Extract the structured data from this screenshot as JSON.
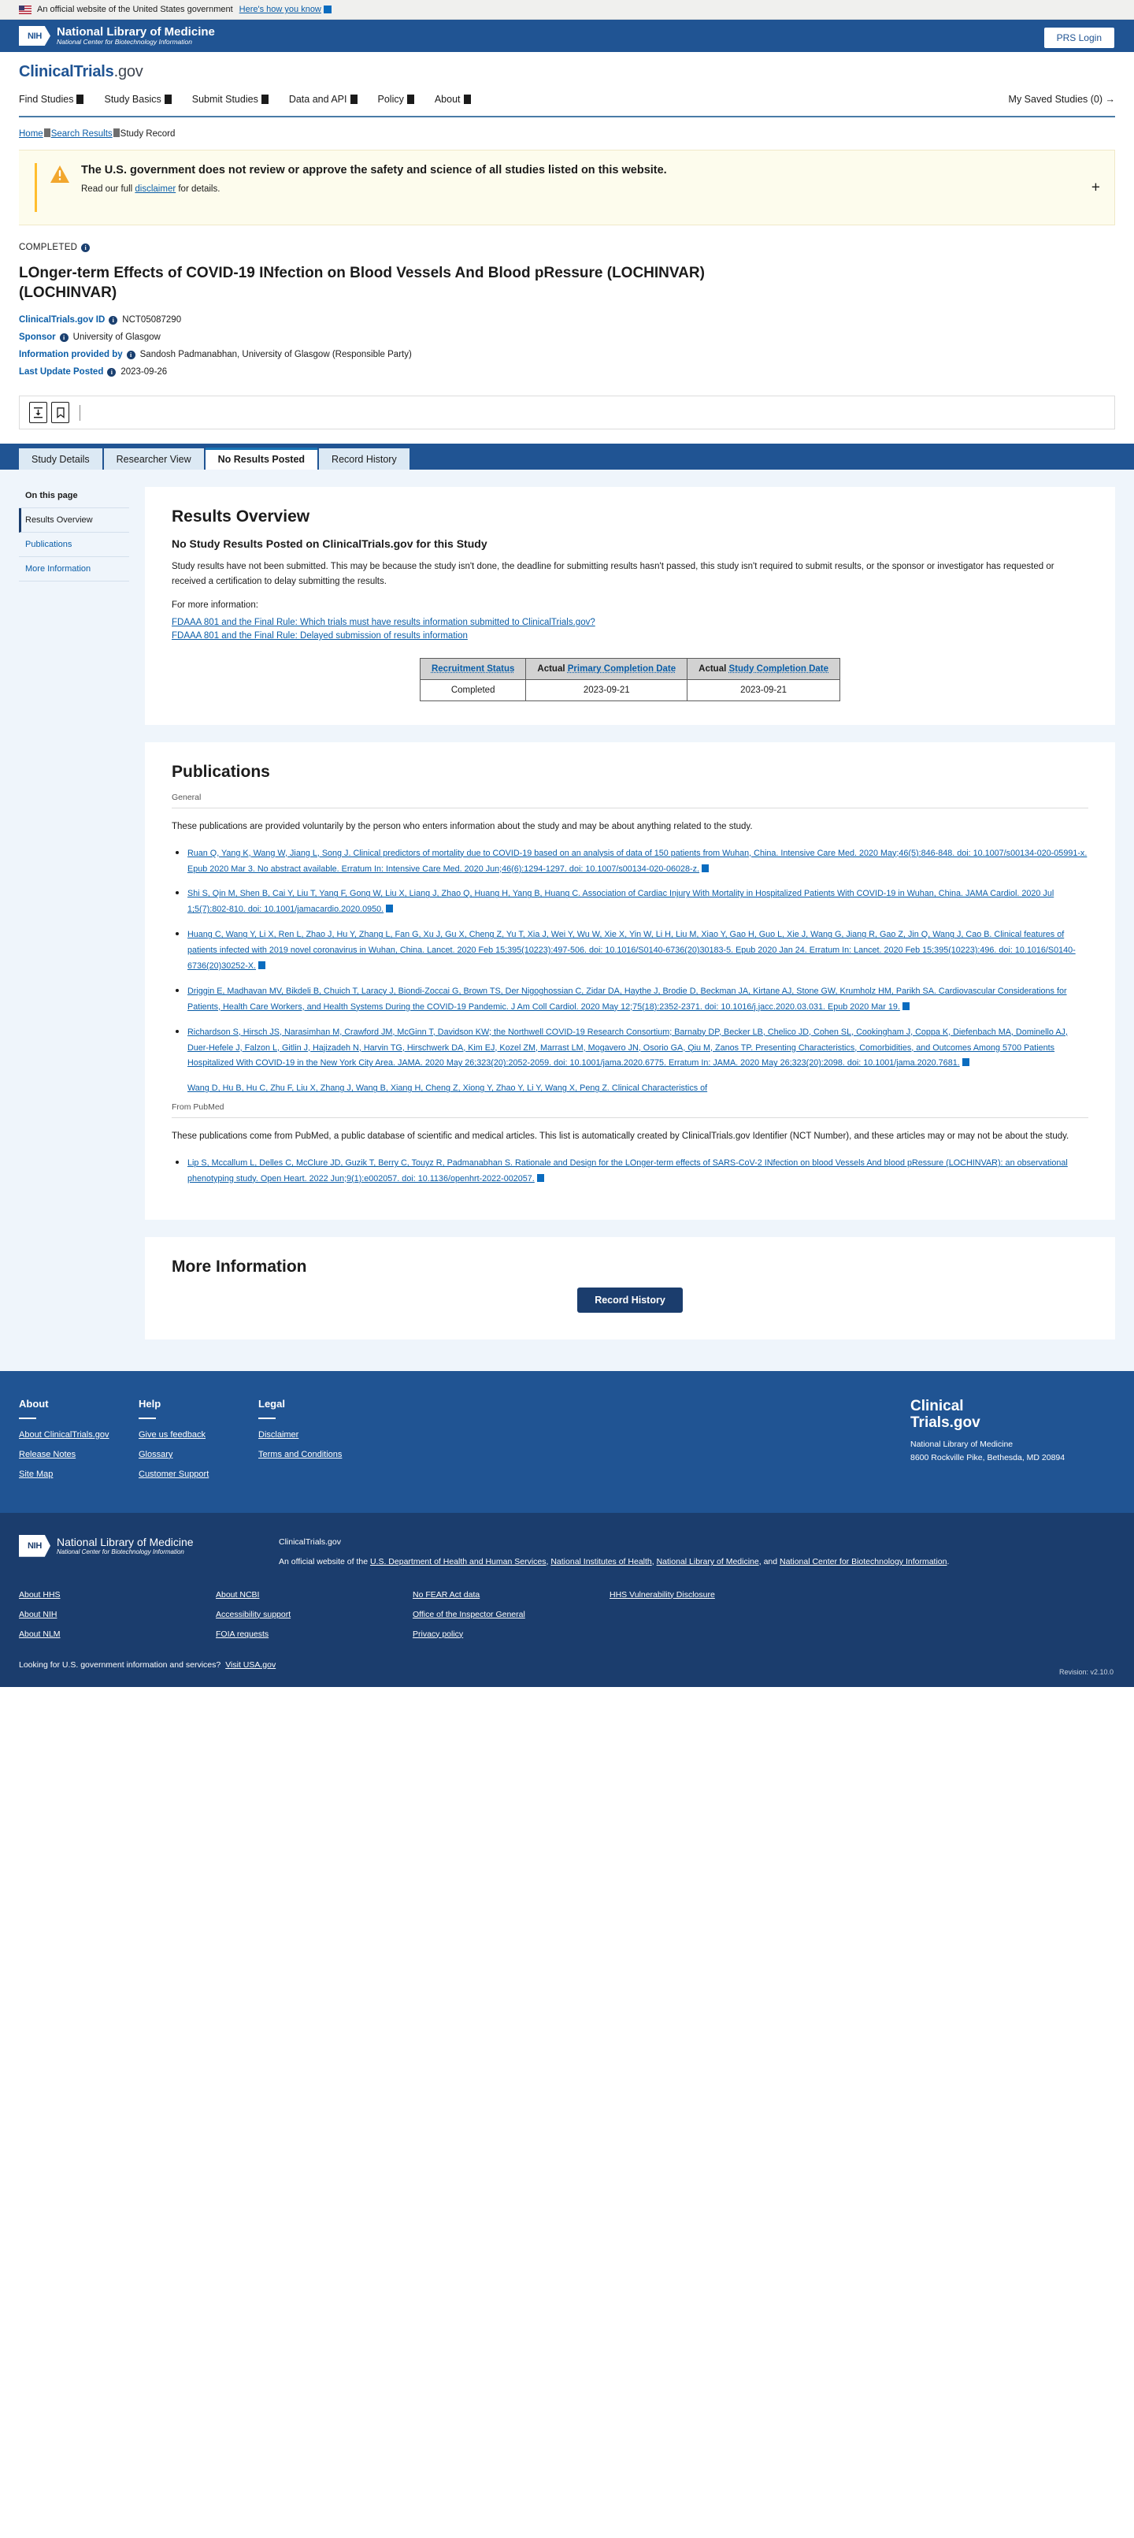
{
  "gov_banner": {
    "text": "An official website of the United States government",
    "link": "Here's how you know"
  },
  "nih": {
    "mark": "NIH",
    "line1": "National Library of Medicine",
    "line2": "National Center for Biotechnology Information"
  },
  "header": {
    "logo_main": "ClinicalTrials",
    "logo_suffix": ".gov",
    "prs_login": "PRS Login",
    "nav": [
      {
        "label": "Find Studies"
      },
      {
        "label": "Study Basics"
      },
      {
        "label": "Submit Studies"
      },
      {
        "label": "Data and API"
      },
      {
        "label": "Policy"
      },
      {
        "label": "About"
      }
    ],
    "saved_studies": "My Saved Studies (0) →"
  },
  "breadcrumb": {
    "home": "Home",
    "search_results": "Search Results",
    "current": "Study Record"
  },
  "alert": {
    "title": "The U.S. government does not review or approve the safety and science of all studies listed on this website.",
    "sub_prefix": "Read our full ",
    "sub_link": "disclaimer",
    "sub_suffix": " for details.",
    "expand": "+"
  },
  "study": {
    "status": "COMPLETED",
    "title": "LOnger-term Effects of COVID-19 INfection on Blood Vessels And Blood pRessure (LOCHINVAR) (LOCHINVAR)",
    "nct_label": "ClinicalTrials.gov ID",
    "nct_value": "NCT05087290",
    "sponsor_label": "Sponsor",
    "sponsor_value": "University of Glasgow",
    "info_label": "Information provided by",
    "info_value": "Sandosh Padmanabhan, University of Glasgow (Responsible Party)",
    "updated_label": "Last Update Posted",
    "updated_value": "2023-09-26"
  },
  "toolbar": {
    "download": "download-icon",
    "save": "bookmark-icon"
  },
  "tabs": [
    {
      "label": "Study Details",
      "active": false
    },
    {
      "label": "Researcher View",
      "active": false
    },
    {
      "label": "No Results Posted",
      "active": true
    },
    {
      "label": "Record History",
      "active": false
    }
  ],
  "sidebar": {
    "title": "On this page",
    "items": [
      {
        "label": "Results Overview",
        "active": true
      },
      {
        "label": "Publications",
        "active": false
      },
      {
        "label": "More Information",
        "active": false
      }
    ]
  },
  "results_overview": {
    "heading": "Results Overview",
    "subheading": "No Study Results Posted on ClinicalTrials.gov for this Study",
    "body": "Study results have not been submitted. This may be because the study isn't done, the deadline for submitting results hasn't passed, this study isn't required to submit results, or the sponsor or investigator has requested or received a certification to delay submitting the results.",
    "more_info_label": "For more information:",
    "links": [
      "FDAAA 801 and the Final Rule: Which trials must have results information submitted to ClinicalTrials.gov?",
      "FDAAA 801 and the Final Rule: Delayed submission of results information"
    ],
    "table": {
      "headers": [
        {
          "prefix": "",
          "link": "Recruitment Status"
        },
        {
          "prefix": "Actual",
          "link": "Primary Completion Date"
        },
        {
          "prefix": "Actual",
          "link": "Study Completion Date"
        }
      ],
      "row": [
        "Completed",
        "2023-09-21",
        "2023-09-21"
      ]
    }
  },
  "publications": {
    "heading": "Publications",
    "general_label": "General",
    "general_intro": "These publications are provided voluntarily by the person who enters information about the study and may be about anything related to the study.",
    "general_items": [
      "Ruan Q, Yang K, Wang W, Jiang L, Song J. Clinical predictors of mortality due to COVID-19 based on an analysis of data of 150 patients from Wuhan, China. Intensive Care Med. 2020 May;46(5):846-848. doi: 10.1007/s00134-020-05991-x. Epub 2020 Mar 3. No abstract available. Erratum In: Intensive Care Med. 2020 Jun;46(6):1294-1297. doi: 10.1007/s00134-020-06028-z.",
      "Shi S, Qin M, Shen B, Cai Y, Liu T, Yang F, Gong W, Liu X, Liang J, Zhao Q, Huang H, Yang B, Huang C. Association of Cardiac Injury With Mortality in Hospitalized Patients With COVID-19 in Wuhan, China. JAMA Cardiol. 2020 Jul 1;5(7):802-810. doi: 10.1001/jamacardio.2020.0950.",
      "Huang C, Wang Y, Li X, Ren L, Zhao J, Hu Y, Zhang L, Fan G, Xu J, Gu X, Cheng Z, Yu T, Xia J, Wei Y, Wu W, Xie X, Yin W, Li H, Liu M, Xiao Y, Gao H, Guo L, Xie J, Wang G, Jiang R, Gao Z, Jin Q, Wang J, Cao B. Clinical features of patients infected with 2019 novel coronavirus in Wuhan, China. Lancet. 2020 Feb 15;395(10223):497-506. doi: 10.1016/S0140-6736(20)30183-5. Epub 2020 Jan 24. Erratum In: Lancet. 2020 Feb 15;395(10223):496. doi: 10.1016/S0140-6736(20)30252-X.",
      "Driggin E, Madhavan MV, Bikdeli B, Chuich T, Laracy J, Biondi-Zoccai G, Brown TS, Der Nigoghossian C, Zidar DA, Haythe J, Brodie D, Beckman JA, Kirtane AJ, Stone GW, Krumholz HM, Parikh SA. Cardiovascular Considerations for Patients, Health Care Workers, and Health Systems During the COVID-19 Pandemic. J Am Coll Cardiol. 2020 May 12;75(18):2352-2371. doi: 10.1016/j.jacc.2020.03.031. Epub 2020 Mar 19.",
      "Richardson S, Hirsch JS, Narasimhan M, Crawford JM, McGinn T, Davidson KW; the Northwell COVID-19 Research Consortium; Barnaby DP, Becker LB, Chelico JD, Cohen SL, Cookingham J, Coppa K, Diefenbach MA, Dominello AJ, Duer-Hefele J, Falzon L, Gitlin J, Hajizadeh N, Harvin TG, Hirschwerk DA, Kim EJ, Kozel ZM, Marrast LM, Mogavero JN, Osorio GA, Qiu M, Zanos TP. Presenting Characteristics, Comorbidities, and Outcomes Among 5700 Patients Hospitalized With COVID-19 in the New York City Area. JAMA. 2020 May 26;323(20):2052-2059. doi: 10.1001/jama.2020.6775. Erratum In: JAMA. 2020 May 26;323(20):2098. doi: 10.1001/jama.2020.7681.",
      "Wang D, Hu B, Hu C, Zhu F, Liu X, Zhang J, Wang B, Xiang H, Cheng Z, Xiong Y, Zhao Y, Li Y, Wang X, Peng Z. Clinical Characteristics of"
    ],
    "pubmed_label": "From PubMed",
    "pubmed_intro": "These publications come from PubMed, a public database of scientific and medical articles. This list is automatically created by ClinicalTrials.gov Identifier (NCT Number), and these articles may or may not be about the study.",
    "pubmed_items": [
      "Lip S, Mccallum L, Delles C, McClure JD, Guzik T, Berry C, Touyz R, Padmanabhan S. Rationale and Design for the LOnger-term effects of SARS-CoV-2 INfection on blood Vessels And blood pRessure (LOCHINVAR): an observational phenotyping study. Open Heart. 2022 Jun;9(1):e002057. doi: 10.1136/openhrt-2022-002057."
    ]
  },
  "more_information": {
    "heading": "More Information",
    "button": "Record History"
  },
  "footer": {
    "columns": [
      {
        "title": "About",
        "links": [
          "About ClinicalTrials.gov",
          "Release Notes",
          "Site Map"
        ]
      },
      {
        "title": "Help",
        "links": [
          "Give us feedback",
          "Glossary",
          "Customer Support"
        ]
      },
      {
        "title": "Legal",
        "links": [
          "Disclaimer",
          "Terms and Conditions"
        ]
      }
    ],
    "brand_line1": "Clinical",
    "brand_line2": "Trials.gov",
    "brand_org": "National Library of Medicine",
    "brand_address": "8600 Rockville Pike, Bethesda, MD 20894"
  },
  "footer_dark": {
    "site": "ClinicalTrials.gov",
    "official_prefix": "An official website of the ",
    "official_links": [
      "U.S. Department of Health and Human Services",
      "National Institutes of Health",
      "National Library of Medicine",
      "National Center for Biotechnology Information"
    ],
    "columns": [
      [
        "About HHS",
        "About NIH",
        "About NLM"
      ],
      [
        "About NCBI",
        "Accessibility support",
        "FOIA requests"
      ],
      [
        "No FEAR Act data",
        "Office of the Inspector General",
        "Privacy policy"
      ],
      [
        "HHS Vulnerability Disclosure"
      ]
    ],
    "usa_text": "Looking for U.S. government information and services?",
    "usa_link": "Visit USA.gov",
    "revision": "Revision: v2.10.0"
  }
}
